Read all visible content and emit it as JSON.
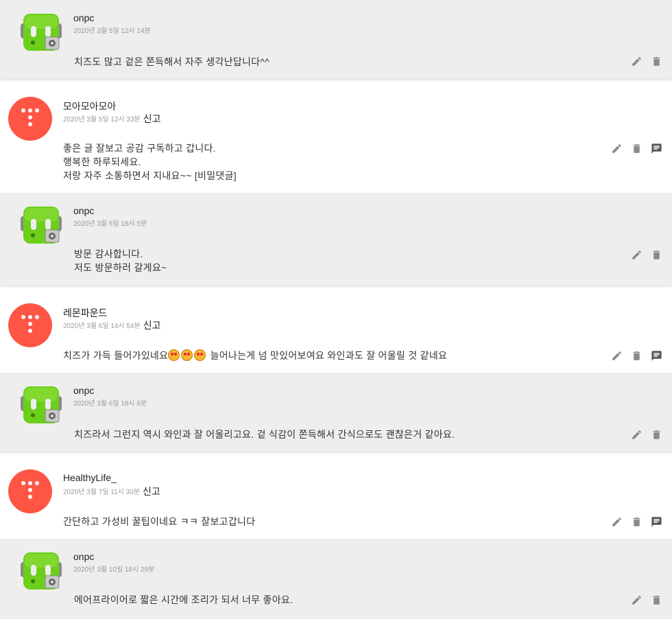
{
  "comments": [
    {
      "kind": "reply",
      "name": "onpc",
      "meta": "2020년 3월 5일 12시 14분",
      "body": "치즈도 많고 겉은 쫀득해서 자주 생각난답니다^^",
      "actions": [
        "edit",
        "delete"
      ]
    },
    {
      "kind": "top",
      "name": "모아모아모아",
      "meta": "2020년 3월 5일 12시 33분",
      "report": "신고",
      "body": "좋은 글 잘보고 공감 구독하고 갑니다.\n행복한 하루되세요.\n저랑 자주 소통하면서 지내요~~ [비밀댓글]",
      "actions": [
        "edit",
        "delete",
        "reply"
      ]
    },
    {
      "kind": "reply",
      "name": "onpc",
      "meta": "2020년 3월 6일 18시 5분",
      "body": "방문 감사합니다.\n저도 방문하러 갈게요~",
      "actions": [
        "edit",
        "delete"
      ]
    },
    {
      "kind": "top",
      "name": "레몬파운드",
      "meta": "2020년 3월 6일 14시 54분",
      "report": "신고",
      "body_prefix": "치즈가 가득 들어가있네요",
      "body_suffix": " 늘어나는게 넘 맛있어보여요 와인과도 잘 어울릴 것 같네요",
      "emoji_count": 3,
      "actions": [
        "edit",
        "delete",
        "reply"
      ]
    },
    {
      "kind": "reply",
      "name": "onpc",
      "meta": "2020년 3월 6일 18시 6분",
      "body": "치즈라서 그런지 역시 와인과 잘 어울리고요. 겉 식감이 쫀득해서 간식으로도 괜찮은거 같아요.",
      "actions": [
        "edit",
        "delete"
      ]
    },
    {
      "kind": "top",
      "name": "HealthyLife_",
      "meta": "2020년 3월 7일 11시 30분",
      "report": "신고",
      "body": "간단하고 가성비 꿀팁이네요 ㅋㅋ 잘보고갑니다",
      "actions": [
        "edit",
        "delete",
        "reply"
      ]
    },
    {
      "kind": "reply",
      "name": "onpc",
      "meta": "2020년 3월 10일 18시 29분",
      "body": "에어프라이어로 짧은 시간에 조리가 되서 너무 좋아요.",
      "actions": [
        "edit",
        "delete"
      ]
    }
  ],
  "icons": {
    "edit": "pencil-icon",
    "delete": "trash-icon",
    "reply": "comment-icon"
  },
  "colors": {
    "reply_bg": "#eeeeee",
    "tistory_red": "#ff5544",
    "robot_green": "#6ccf1a",
    "icon_gray": "#8a8a8a"
  }
}
